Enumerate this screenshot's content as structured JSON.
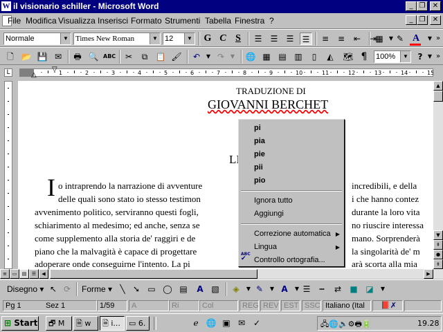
{
  "window": {
    "title": "il visionario schiller - Microsoft Word",
    "app_letter": "W"
  },
  "menu": [
    "File",
    "Modifica",
    "Visualizza",
    "Inserisci",
    "Formato",
    "Strumenti",
    "Tabella",
    "Finestra",
    "?"
  ],
  "formatting": {
    "style": "Normale",
    "font": "Times New Roman",
    "size": "12",
    "bold": "G",
    "italic": "C",
    "underline": "S"
  },
  "standard": {
    "zoom": "100%"
  },
  "document": {
    "heading_small": "TRADUZIONE DI",
    "heading_large": "GIOVANNI BERCHET",
    "partial_title": "LI",
    "drop_cap": "I",
    "lines_left": [
      "o intraprendo la narrazione di avventure",
      "delle quali sono stato io stesso testimon",
      "avvenimento politico, serviranno questi fogli,",
      "schiarimento al medesimo; ed anche, senza se",
      "come supplemento alla storia de' raggiri e de",
      "piano che la malvagità è capace di progettare",
      "adoperare onde conseguirne l'intento. La pi"
    ],
    "lines_right": [
      "incredibili, e della",
      "i che hanno contez",
      "durante la loro vita",
      "no riuscire interessa",
      "mano. Sorprenderà",
      "la singolarità de' m",
      "arà scorta alla mia"
    ]
  },
  "context_menu": {
    "suggestions": [
      "pi",
      "pia",
      "pie",
      "pii",
      "pio"
    ],
    "ignore_all": "Ignora tutto",
    "add": "Aggiungi",
    "autocorrect": "Correzione automatica",
    "language": "Lingua",
    "spellcheck": "Controllo ortografia..."
  },
  "drawing": {
    "draw_label": "Disegno",
    "shapes_label": "Forme"
  },
  "status": {
    "page": "Pg 1",
    "section": "Sez 1",
    "pages": "1/59",
    "at": "A",
    "line": "Ri",
    "col": "Col",
    "rec": "REG",
    "rev": "REV",
    "ext": "EST",
    "ovr": "SSC",
    "language": "Italiano (Ital"
  },
  "taskbar": {
    "start": "Start",
    "buttons": [
      "M",
      "w",
      "i...",
      "6."
    ],
    "clock": "19.28"
  },
  "colors": {
    "titlebar": "#000080",
    "face": "#c0c0c0",
    "highlight_red": "#ff0000",
    "font_color": "#ff0000"
  }
}
